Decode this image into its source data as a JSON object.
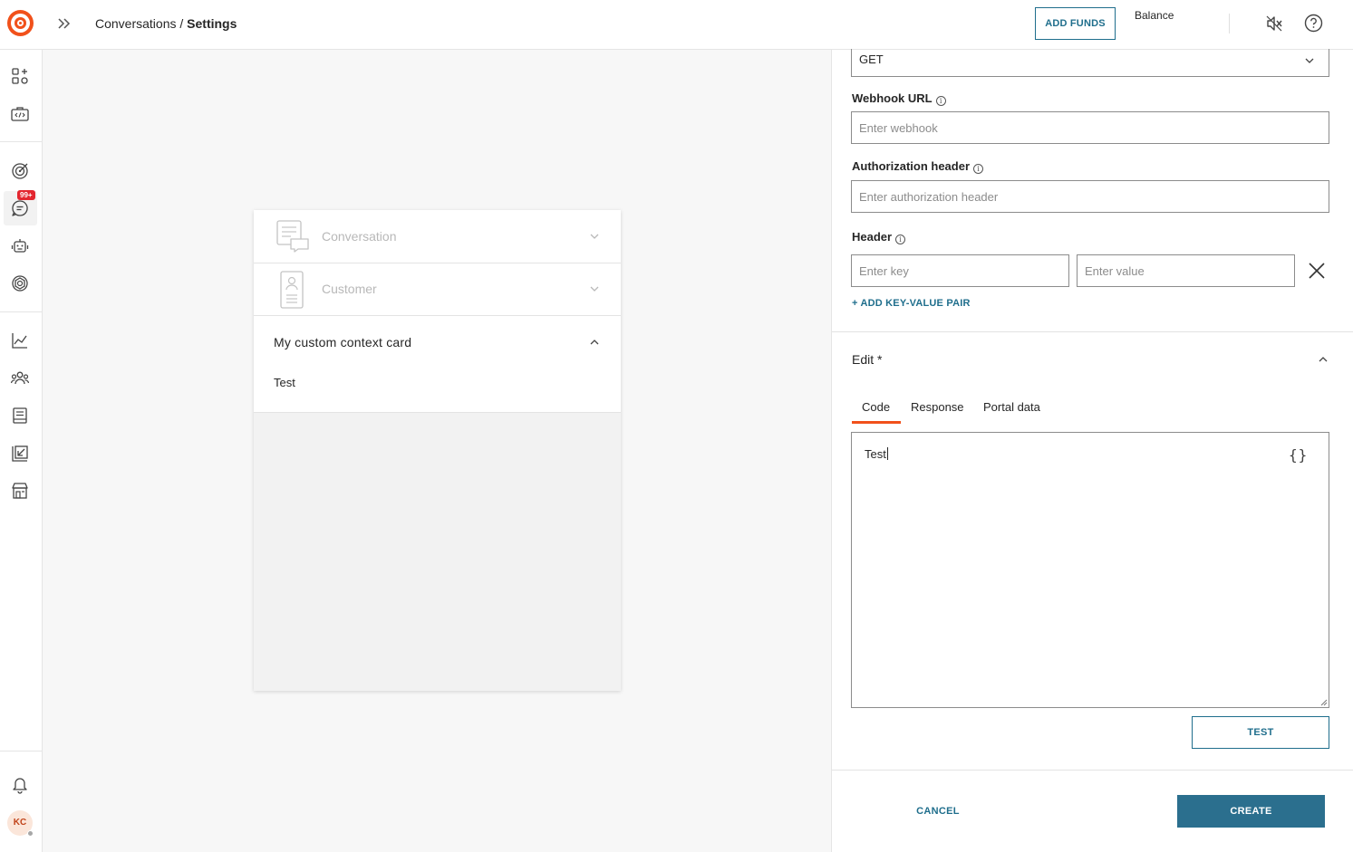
{
  "header": {
    "breadcrumb_parent": "Conversations",
    "breadcrumb_separator": " / ",
    "breadcrumb_current": "Settings",
    "add_funds_label": "ADD FUNDS",
    "balance_label": "Balance"
  },
  "sidebar": {
    "notification_badge": "99+",
    "avatar_initials": "KC",
    "icons": [
      "apps-add-icon",
      "developer-toolbox-icon",
      "target-icon",
      "conversations-icon",
      "bot-icon",
      "openai-icon",
      "analytics-icon",
      "people-icon",
      "book-icon",
      "exchange-icon",
      "store-icon",
      "bell-icon"
    ]
  },
  "preview": {
    "rows": [
      {
        "label": "Conversation",
        "icon": "conversation-card-icon"
      },
      {
        "label": "Customer",
        "icon": "customer-card-icon"
      }
    ],
    "custom_card_title": "My custom context card",
    "custom_card_body": "Test"
  },
  "form": {
    "method_value": "GET",
    "webhook_label": "Webhook URL",
    "webhook_placeholder": "Enter webhook",
    "auth_label": "Authorization header",
    "auth_placeholder": "Enter authorization header",
    "header_label": "Header",
    "key_placeholder": "Enter key",
    "value_placeholder": "Enter value",
    "add_kv_label": "+ ADD KEY-VALUE PAIR",
    "edit_title": "Edit *",
    "tabs": [
      "Code",
      "Response",
      "Portal data"
    ],
    "active_tab": "Code",
    "code_value": "Test",
    "braces_glyph": "{}",
    "test_label": "TEST",
    "cancel_label": "CANCEL",
    "create_label": "CREATE"
  },
  "colors": {
    "accent": "#f1511b",
    "primary": "#1f6e8c",
    "badge": "#e3262f"
  }
}
